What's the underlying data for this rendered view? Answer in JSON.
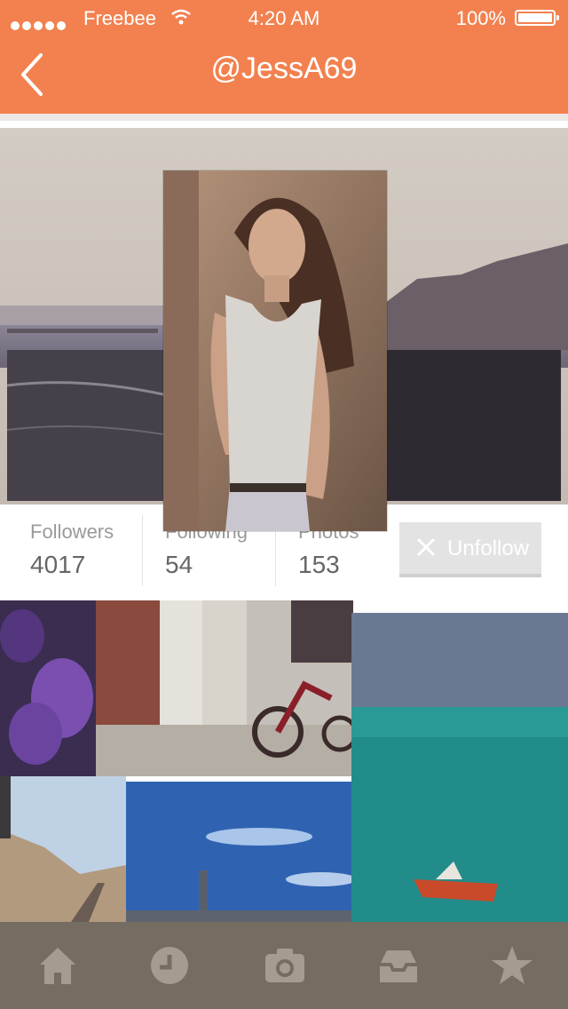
{
  "status_bar": {
    "carrier": "Freebee",
    "time": "4:20 AM",
    "battery": "100%"
  },
  "nav": {
    "title": "@JessA69",
    "back_icon": "chevron-left-icon"
  },
  "stats": {
    "followers_label": "Followers",
    "followers_value": "4017",
    "following_label": "Following",
    "following_value": "54",
    "photos_label": "Photos",
    "photos_value": "153"
  },
  "actions": {
    "unfollow_label": "Unfollow",
    "unfollow_icon": "close-icon"
  },
  "tabbar": {
    "items": [
      "home-icon",
      "clock-icon",
      "camera-icon",
      "inbox-icon",
      "star-icon"
    ]
  },
  "colors": {
    "accent": "#f2814f",
    "tabbar": "#756d62"
  }
}
